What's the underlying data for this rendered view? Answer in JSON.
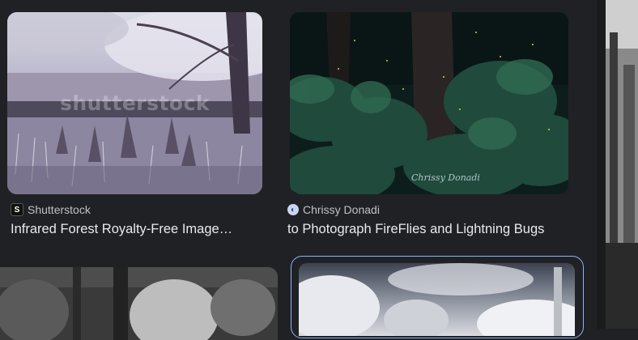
{
  "results": [
    {
      "source": "Shutterstock",
      "source_icon": "shutterstock-favicon",
      "title": "Infrared Forest Royalty-Free Image…",
      "watermark": "shutterstock"
    },
    {
      "source": "Chrissy Donadi",
      "source_icon": "chrissy-donadi-favicon",
      "title": "to Photograph FireFlies and Lightning Bugs",
      "signature": "Chrissy Donadi"
    }
  ],
  "colors": {
    "background": "#202124",
    "title_text": "#e8eaed",
    "source_text": "#bdc1c6",
    "selected_border": "#8ab4f8"
  }
}
